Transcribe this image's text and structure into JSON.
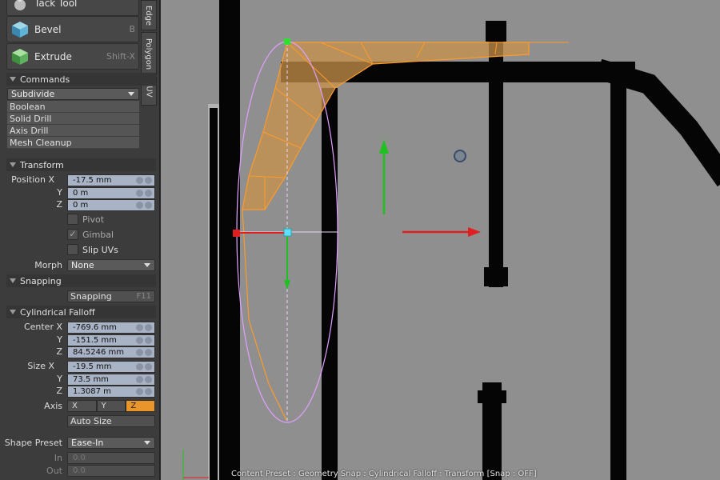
{
  "tools": [
    {
      "label": "Tack Tool",
      "key": ""
    },
    {
      "label": "Bevel",
      "key": "B"
    },
    {
      "label": "Extrude",
      "key": "Shift-X"
    }
  ],
  "side_tabs": [
    "Edge",
    "Polygon",
    "UV"
  ],
  "commands": {
    "title": "Commands",
    "dropdown": "Subdivide",
    "items": [
      "Boolean",
      "Solid Drill",
      "Axis Drill",
      "Mesh Cleanup"
    ]
  },
  "transform": {
    "title": "Transform",
    "position_label": "Position X",
    "y_label": "Y",
    "z_label": "Z",
    "x": "-17.5 mm",
    "y": "0 m",
    "z": "0 m",
    "pivot": "Pivot",
    "gimbal": "Gimbal",
    "slip_uvs": "Slip UVs",
    "morph_label": "Morph",
    "morph_value": "None"
  },
  "snapping": {
    "title": "Snapping",
    "button": "Snapping",
    "key": "F11"
  },
  "falloff": {
    "title": "Cylindrical Falloff",
    "center_label": "Center X",
    "y_label": "Y",
    "z_label": "Z",
    "center_x": "-769.6 mm",
    "center_y": "-151.5 mm",
    "center_z": "84.5246 mm",
    "size_label": "Size X",
    "size_x": "-19.5 mm",
    "size_y": "73.5 mm",
    "size_z": "1.3087 m",
    "axis_label": "Axis",
    "axis_options": [
      "X",
      "Y",
      "Z"
    ],
    "axis_selected": "Z",
    "auto_size": "Auto Size",
    "shape_preset_label": "Shape Preset",
    "shape_preset_value": "Ease-In",
    "in_label": "In",
    "out_label": "Out",
    "in_value": "0.0",
    "out_value": "0.0"
  },
  "status_bar": "Content Preset : Geometry Snap : Cylindrical Falloff : Transform  [Snap : OFF]",
  "colors": {
    "accent": "#e8952b",
    "field": "#a8b3c5",
    "viewport_bg": "#8f8f8f",
    "x_axis": "#e02020",
    "y_axis": "#20c020"
  }
}
